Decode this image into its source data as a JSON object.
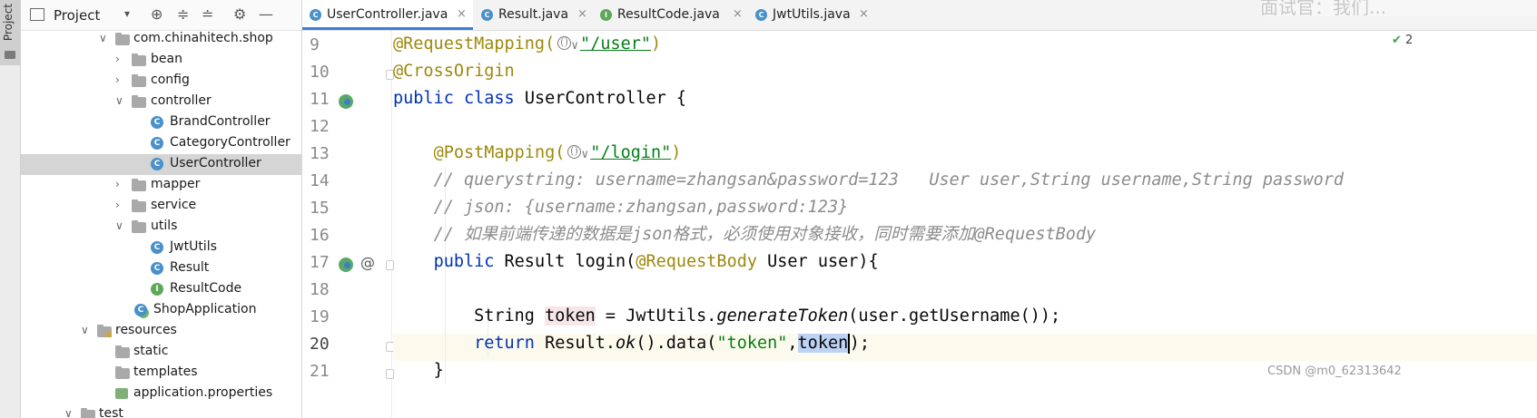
{
  "project_panel": {
    "title": "Project",
    "side_tab_label": "Project",
    "tree": [
      {
        "label": "com.chinahitech.shop",
        "kind": "package",
        "expanded": true
      },
      {
        "label": "bean",
        "kind": "package",
        "expanded": false
      },
      {
        "label": "config",
        "kind": "package",
        "expanded": false
      },
      {
        "label": "controller",
        "kind": "package",
        "expanded": true
      },
      {
        "label": "BrandController",
        "kind": "class"
      },
      {
        "label": "CategoryController",
        "kind": "class"
      },
      {
        "label": "UserController",
        "kind": "class",
        "selected": true
      },
      {
        "label": "mapper",
        "kind": "package",
        "expanded": false
      },
      {
        "label": "service",
        "kind": "package",
        "expanded": false
      },
      {
        "label": "utils",
        "kind": "package",
        "expanded": true
      },
      {
        "label": "JwtUtils",
        "kind": "class"
      },
      {
        "label": "Result",
        "kind": "class"
      },
      {
        "label": "ResultCode",
        "kind": "interface"
      },
      {
        "label": "ShopApplication",
        "kind": "app"
      },
      {
        "label": "resources",
        "kind": "resources",
        "expanded": true
      },
      {
        "label": "static",
        "kind": "folder"
      },
      {
        "label": "templates",
        "kind": "folder"
      },
      {
        "label": "application.properties",
        "kind": "properties"
      },
      {
        "label": "test",
        "kind": "folder",
        "expanded": true
      }
    ]
  },
  "tabs": [
    {
      "label": "UserController.java",
      "icon": "class-icon",
      "active": true
    },
    {
      "label": "Result.java",
      "icon": "class-icon",
      "active": false
    },
    {
      "label": "ResultCode.java",
      "icon": "interface-icon",
      "active": false
    },
    {
      "label": "JwtUtils.java",
      "icon": "class-icon",
      "active": false
    }
  ],
  "editor": {
    "line_numbers": [
      "9",
      "10",
      "11",
      "12",
      "13",
      "14",
      "15",
      "16",
      "17",
      "18",
      "19",
      "20",
      "21"
    ],
    "current_line": "20",
    "inspection_count": "2",
    "code": {
      "l9_ann": "@RequestMapping(",
      "l9_str": "\"/user\"",
      "l9_close": ")",
      "l10": "@CrossOrigin",
      "l11_kw1": "public",
      "l11_kw2": "class",
      "l11_rest": "UserController {",
      "l13_ann": "@PostMapping(",
      "l13_str": "\"/login\"",
      "l13_close": ")",
      "l14": "// querystring: username=zhangsan&password=123   User user,String username,String password",
      "l15": "// json: {username:zhangsan,password:123}",
      "l16": "// 如果前端传递的数据是json格式，必须使用对象接收，同时需要添加@RequestBody",
      "l17_kw": "public",
      "l17_mid": "Result login(",
      "l17_ann": "@RequestBody",
      "l17_rest": "User user){",
      "l19_a": "String ",
      "l19_tok": "token",
      "l19_b": " = JwtUtils.",
      "l19_fn": "generateToken",
      "l19_c": "(user.getUsername());",
      "l20_kw": "return",
      "l20_a": "Result.",
      "l20_fn": "ok",
      "l20_b": "().data(",
      "l20_str": "\"token\"",
      "l20_comma": ",",
      "l20_sel": "token",
      "l20_end": ");",
      "l21": "}"
    }
  },
  "watermark": "CSDN @m0_62313642",
  "faded_overlay_text": "面试官：我们..."
}
